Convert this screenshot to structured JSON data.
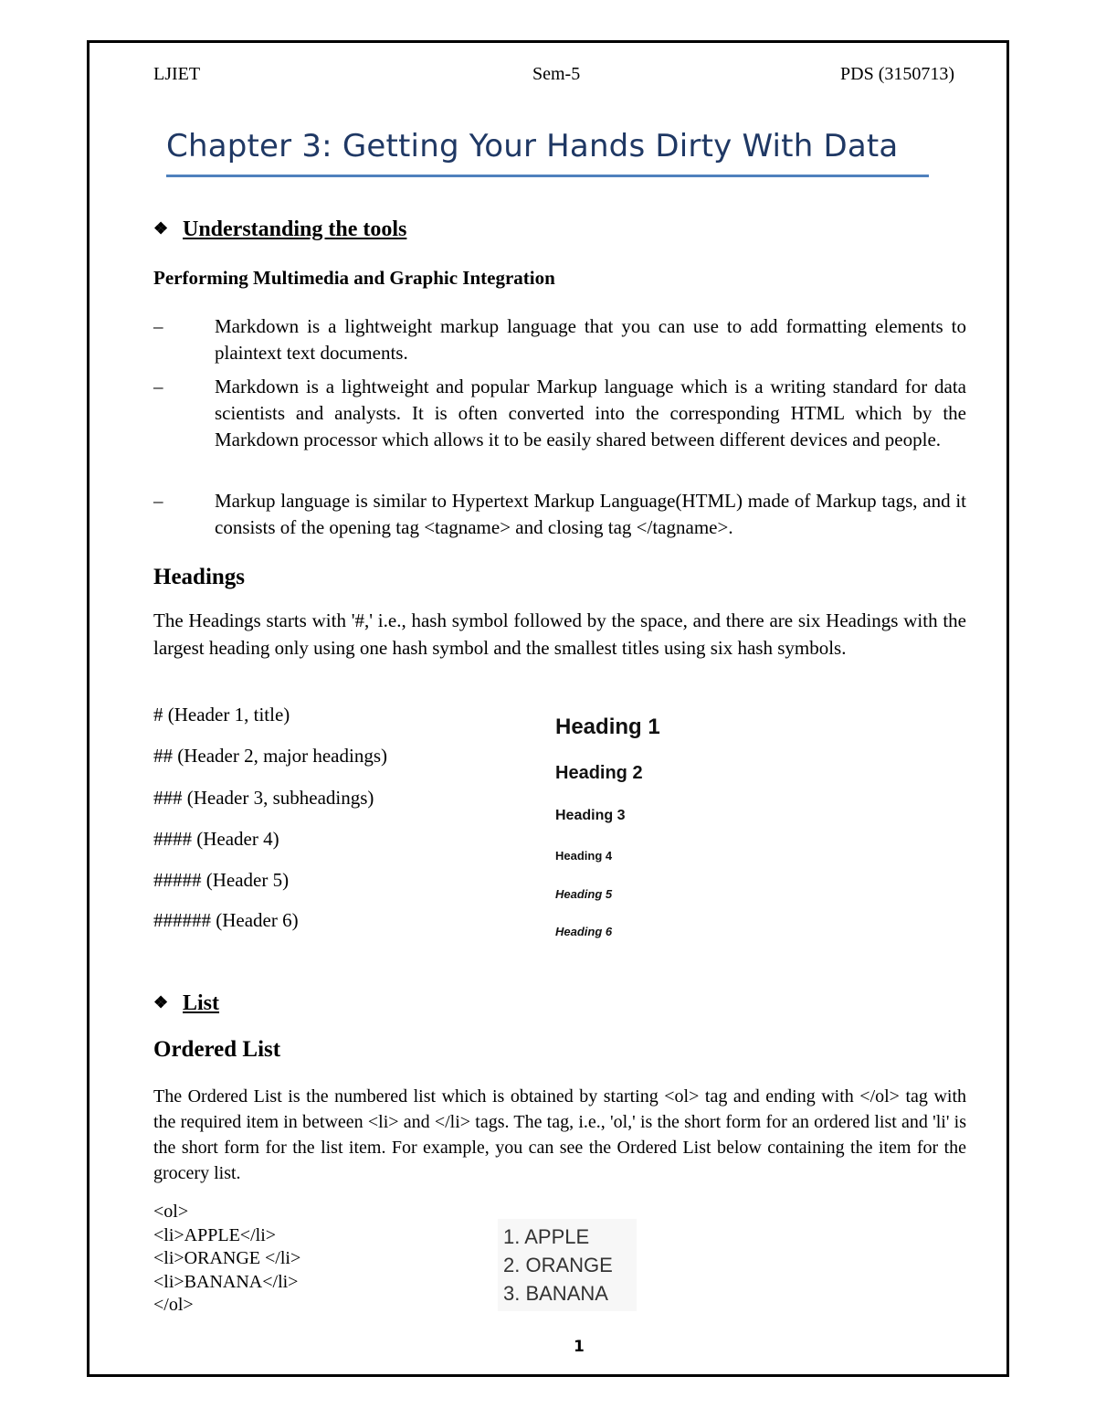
{
  "header": {
    "left": "LJIET",
    "center": "Sem-5",
    "right": "PDS (3150713)"
  },
  "chapter_title": "Chapter 3: Getting Your Hands Dirty With Data",
  "section_tools": {
    "bullet_icon": "four-diamond-icon",
    "heading": "Understanding the tools",
    "subheading": "Performing Multimedia and Graphic Integration",
    "bullets": [
      {
        "dash": "–",
        "text": "Markdown is a lightweight markup language that you can use to add formatting elements to plaintext text documents."
      },
      {
        "dash": "–",
        "text": "Markdown is a lightweight and popular Markup language which is a writing standard for data scientists and analysts. It is often converted into the corresponding HTML which by the Markdown processor which allows it to be easily shared between different devices and people."
      },
      {
        "dash": "–",
        "text": "Markup language  is similar to Hypertext Markup Language(HTML) made  of Markup tags, and it consists of the opening tag <tagname> and closing tag </tagname>."
      }
    ]
  },
  "headings_section": {
    "title": "Headings",
    "paragraph": "The Headings starts with '#,' i.e., hash symbol followed by the space, and there are six Headings with the largest heading only using one hash symbol and the smallest titles using six hash symbols.",
    "syntax_lines": [
      "# (Header 1, title)",
      "## (Header 2, major headings)",
      "### (Header 3, subheadings)",
      "#### (Header 4)",
      "##### (Header 5)",
      "###### (Header 6)"
    ],
    "rendered_examples": [
      "Heading 1",
      "Heading 2",
      "Heading 3",
      "Heading 4",
      "Heading 5",
      "Heading 6"
    ]
  },
  "section_list": {
    "bullet_icon": "four-diamond-icon",
    "heading": "List",
    "subheading": "Ordered List",
    "paragraph": "The Ordered List is the  numbered list which is obtained  by starting <ol> tag and ending with </ol> tag with the required item in between <li> and </li> tags. The tag, i.e., 'ol,' is the short form for an ordered list and 'li' is the short form for the list item. For example, you can see the Ordered List below containing the item for the grocery list.",
    "code_lines": [
      "<ol>",
      "<li>APPLE</li>",
      "<li>ORANGE  </li>",
      "<li>BANANA</li>",
      "</ol>"
    ],
    "rendered_items": [
      "1. APPLE",
      "2. ORANGE",
      "3. BANANA"
    ]
  },
  "footer": {
    "page_number": "1"
  },
  "colors": {
    "title": "#1f3864",
    "title_rule": "#4f81bd",
    "border": "#000000"
  }
}
